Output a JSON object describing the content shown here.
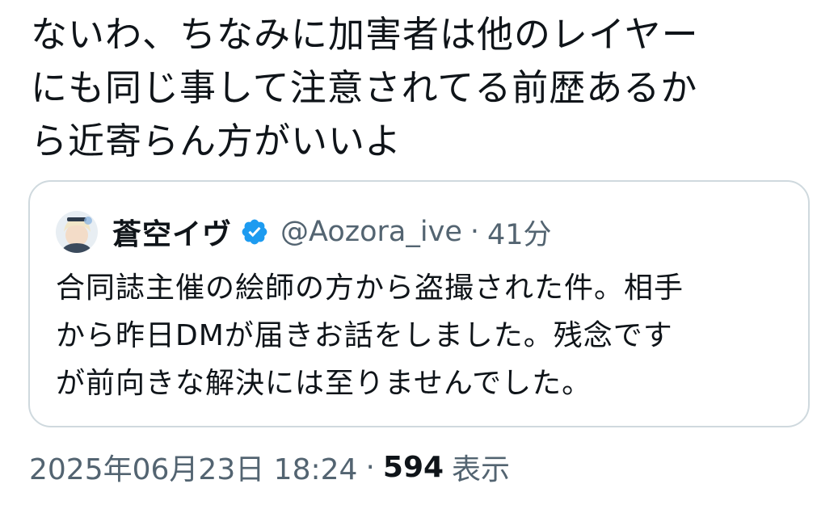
{
  "tweet": {
    "text": "ないわ、ちなみに加害者は他のレイヤー\nにも同じ事して注意されてる前歴あるか\nら近寄らん方がいいよ"
  },
  "quote": {
    "display_name": "蒼空イヴ",
    "verified_icon": "verified-badge-icon",
    "handle": "@Aozora_ive",
    "separator": "·",
    "time": "41分",
    "text": "合同誌主催の絵師の方から盗撮された件。相手\nから昨日DMが届きお話をしました。残念です\nが前向きな解決には至りませんでした。"
  },
  "meta": {
    "timestamp": "2025年06月23日 18:24",
    "separator": "·",
    "views_count": "594",
    "views_label": "表示"
  },
  "colors": {
    "text_primary": "#0f1419",
    "text_secondary": "#536471",
    "border": "#cfd9de",
    "verified_blue": "#1d9bf0"
  }
}
